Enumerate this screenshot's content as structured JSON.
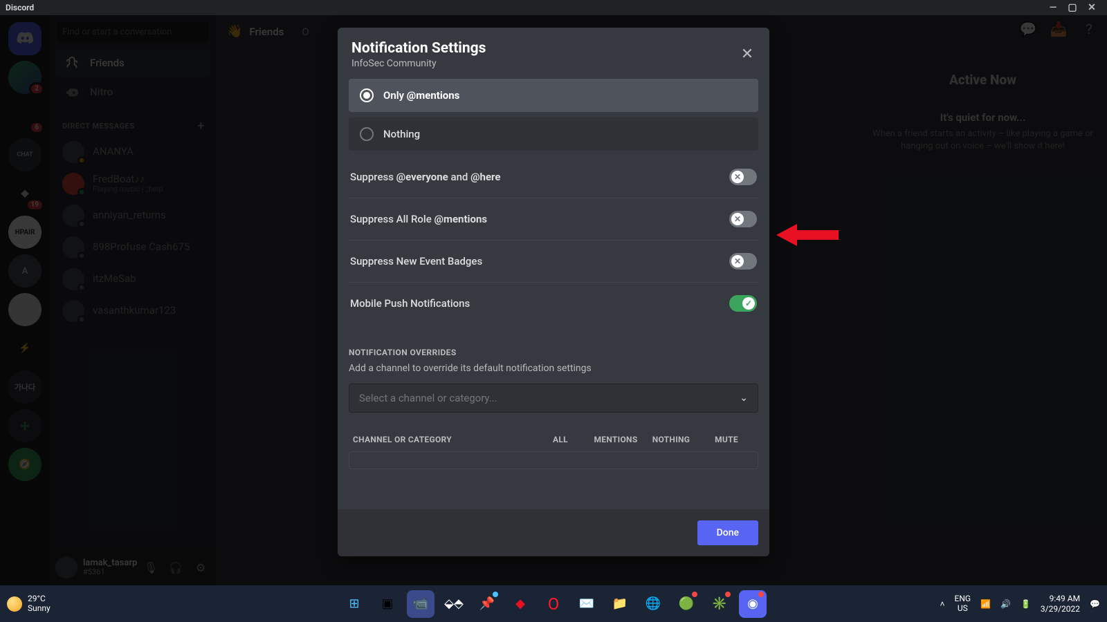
{
  "window": {
    "title": "Discord"
  },
  "search": {
    "placeholder": "Find or start a conversation"
  },
  "nav": {
    "friends": "Friends",
    "nitro": "Nitro"
  },
  "dm_header": "DIRECT MESSAGES",
  "dms": [
    {
      "name": "ANANYA"
    },
    {
      "name": "FredBoat♪♪",
      "sub": "Playing music | ;;help"
    },
    {
      "name": "anniyan_returns"
    },
    {
      "name": "898Profuse Cash675"
    },
    {
      "name": "itzMeSab"
    },
    {
      "name": "vasanthkumar123"
    }
  ],
  "server_badges": [
    "2",
    "6",
    "19"
  ],
  "user": {
    "name": "lamak_tasarp",
    "tag": "#5361"
  },
  "tabs": {
    "friends": "Friends",
    "online_initial": "O"
  },
  "right_panel": {
    "title": "Active Now",
    "quiet": "It's quiet for now...",
    "quiet_sub": "When a friend starts an activity – like playing a game or hanging out on voice – we'll show it here!"
  },
  "modal": {
    "title": "Notification Settings",
    "server": "InfoSec Community",
    "radio": {
      "only_mentions_prefix": "Only ",
      "only_mentions_bold": "@mentions",
      "nothing": "Nothing"
    },
    "toggles": {
      "suppress_everyone_pre": "Suppress ",
      "suppress_everyone_b1": "@everyone",
      "suppress_everyone_mid": " and ",
      "suppress_everyone_b2": "@here",
      "suppress_role_pre": "Suppress All Role ",
      "suppress_role_b": "@mentions",
      "suppress_badges": "Suppress New Event Badges",
      "mobile_push": "Mobile Push Notifications"
    },
    "overrides": {
      "header": "NOTIFICATION OVERRIDES",
      "sub": "Add a channel to override its default notification settings",
      "placeholder": "Select a channel or category...",
      "cols": {
        "cat": "CHANNEL OR CATEGORY",
        "all": "ALL",
        "mentions": "MENTIONS",
        "nothing": "NOTHING",
        "mute": "MUTE"
      }
    },
    "done": "Done"
  },
  "taskbar": {
    "temp": "29°C",
    "cond": "Sunny",
    "lang1": "ENG",
    "lang2": "US",
    "time": "9:49 AM",
    "date": "3/29/2022"
  }
}
